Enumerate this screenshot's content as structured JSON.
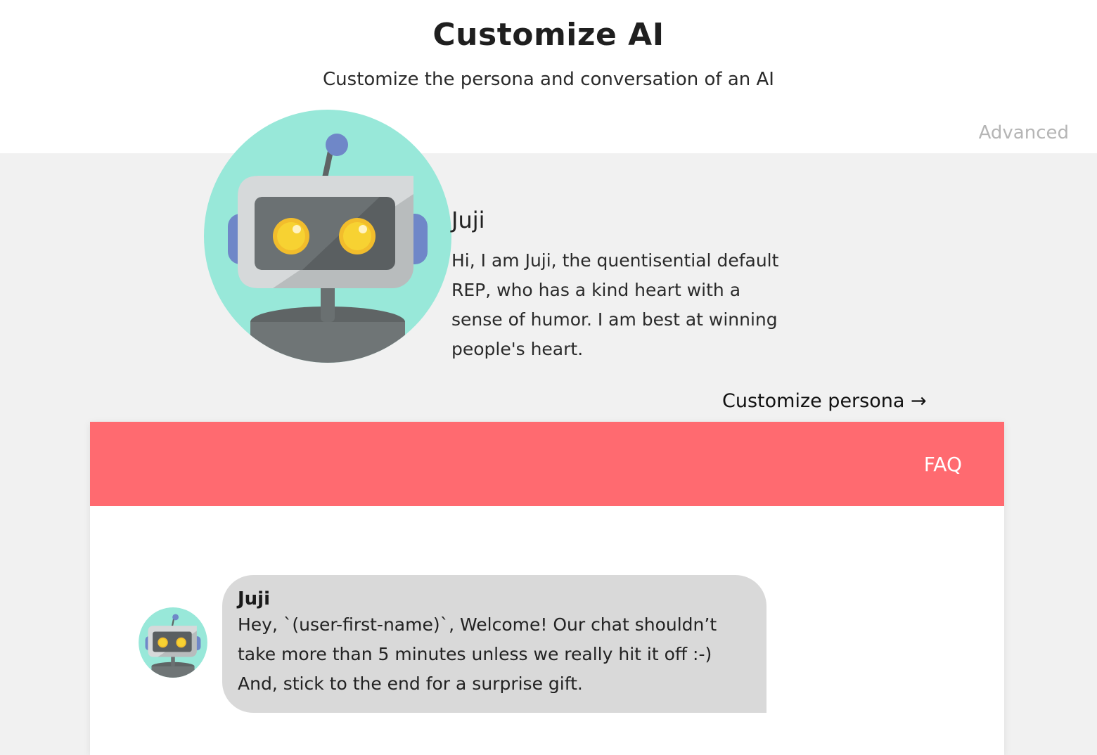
{
  "header": {
    "title": "Customize AI",
    "subtitle": "Customize the persona and conversation of an AI",
    "advanced_label": "Advanced"
  },
  "persona": {
    "name": "Juji",
    "description": "Hi, I am Juji, the quentisential default REP, who has a kind heart with a sense of humor. I am best at winning people's heart.",
    "customize_label": "Customize persona →",
    "avatar_icon": "robot-avatar-icon"
  },
  "chat": {
    "tab_label": "FAQ",
    "message": {
      "sender": "Juji",
      "text": "Hey, `(user-first-name)`, Welcome! Our chat shouldn’t take more than 5 minutes unless we really hit it off :-) And, stick to the end for a surprise gift."
    }
  },
  "colors": {
    "accent": "#ff6a70",
    "background": "#f1f1f1",
    "bubble": "#d9d9d9",
    "avatar_bg": "#98e8d9"
  }
}
